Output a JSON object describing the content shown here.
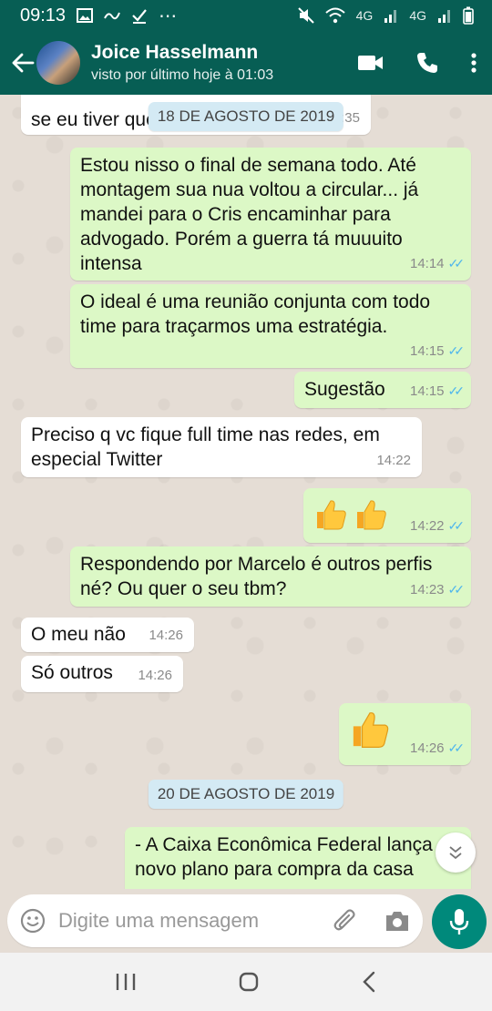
{
  "status_bar": {
    "time": "09:13",
    "net1": "4G",
    "net2": "4G"
  },
  "header": {
    "back_icon": "arrow-left-icon",
    "contact_name": "Joice Hasselmann",
    "contact_status": "visto por último hoje à 01:03",
    "icons": [
      "video-call-icon",
      "phone-icon",
      "more-vert-icon"
    ]
  },
  "chat": {
    "messages": [
      {
        "dir": "in",
        "text": "se eu tiver que ... mudar de equipe",
        "time": "13:35"
      },
      {
        "type": "date",
        "text": "18 DE AGOSTO DE 2019"
      },
      {
        "dir": "out",
        "text": "Estou nisso o final de semana todo. Até montagem sua nua voltou a circular... já mandei para o Cris encaminhar para advogado. Porém a guerra tá muuuito intensa",
        "time": "14:14"
      },
      {
        "dir": "out",
        "text": "O ideal é uma reunião conjunta com todo time para traçarmos uma estratégia.",
        "time": "14:15"
      },
      {
        "dir": "out",
        "text": "Sugestão",
        "time": "14:15"
      },
      {
        "dir": "in",
        "text": "Preciso q vc fique full time nas redes, em especial Twitter",
        "time": "14:22"
      },
      {
        "dir": "out",
        "emoji": "thumbs-up-x2",
        "time": "14:22"
      },
      {
        "dir": "out",
        "text": "Respondendo por Marcelo é outros perfis né? Ou quer o seu tbm?",
        "time": "14:23"
      },
      {
        "dir": "in",
        "text": "O meu não",
        "time": "14:26"
      },
      {
        "dir": "in",
        "text": "Só outros",
        "time": "14:26"
      },
      {
        "dir": "out",
        "emoji": "thumbs-up",
        "time": "14:26"
      },
      {
        "type": "date",
        "text": "20 DE AGOSTO DE 2019"
      },
      {
        "dir": "out",
        "text": "- A Caixa Econômica Federal lança novo plano para compra da casa"
      }
    ]
  },
  "composer": {
    "placeholder": "Digite uma mensagem",
    "icons": [
      "emoji-icon",
      "attach-icon",
      "camera-icon",
      "mic-icon"
    ]
  },
  "colors": {
    "header": "#075e54",
    "outgoing_bubble": "#dcf8c6",
    "incoming_bubble": "#ffffff",
    "read_ticks": "#4fb6ec",
    "mic_button": "#00897b"
  }
}
